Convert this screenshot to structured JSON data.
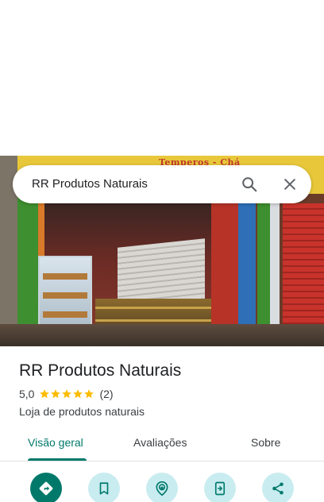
{
  "search": {
    "query": "RR Produtos Naturais"
  },
  "photo": {
    "sign_text": "Temperos - Chá"
  },
  "place": {
    "name": "RR Produtos Naturais",
    "rating": "5,0",
    "stars": 5,
    "review_count": "(2)",
    "category": "Loja de produtos naturais"
  },
  "tabs": [
    {
      "label": "Visão geral",
      "active": true
    },
    {
      "label": "Avaliações",
      "active": false
    },
    {
      "label": "Sobre",
      "active": false
    }
  ],
  "actions": [
    {
      "icon": "directions-icon"
    },
    {
      "icon": "bookmark-icon"
    },
    {
      "icon": "nearby-icon"
    },
    {
      "icon": "send-to-phone-icon"
    },
    {
      "icon": "share-icon"
    }
  ],
  "colors": {
    "accent": "#00796b",
    "star": "#fbbc04",
    "action_bg": "#c9ecf0"
  }
}
